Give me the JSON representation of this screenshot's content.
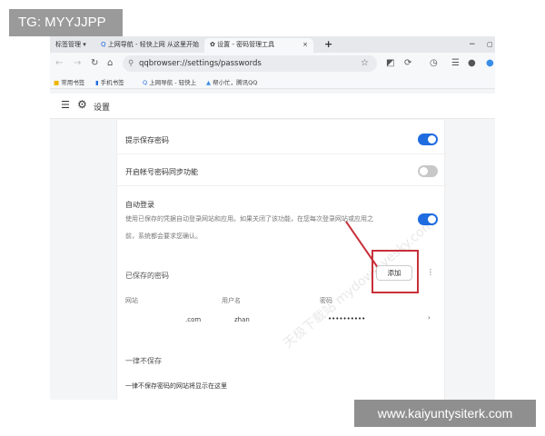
{
  "overlay": {
    "tag": "TG: MYYJJPP",
    "site": "www.kaiyuntysiterk.com"
  },
  "tabs": {
    "manager": "标签管理 ▾",
    "tab1": "上网导航 - 轻快上网 从这里开始",
    "tab2": "设置 - 密码管理工具",
    "close": "×",
    "new": "+"
  },
  "window": {
    "minimize": "−",
    "maximize": "▢"
  },
  "toolbar": {
    "url": "qqbrowser://settings/passwords"
  },
  "bookmarks": [
    "常用书签",
    "手机书签",
    "上网导航 - 轻快上",
    "帮小忙，腾讯QQ"
  ],
  "header": {
    "title": "设置"
  },
  "watermark": "天极下载站 mydown.yesky.com",
  "settings": {
    "offer_save": {
      "label": "提示保存密码",
      "on": true
    },
    "sync": {
      "label": "开启帐号密码同步功能",
      "on": false
    },
    "autologin": {
      "label": "自动登录",
      "desc1": "使用已保存的凭据自动登录网站和应用。如果关闭了该功能，在您每次登录网站或应用之",
      "desc2": "前，系统都会要求您确认。",
      "on": true
    }
  },
  "saved": {
    "title": "已保存的密码",
    "add": "添加",
    "more": "⋮",
    "columns": {
      "site": "网站",
      "user": "用户名",
      "password": "密码"
    },
    "rows": [
      {
        "site": ".com",
        "user": "zhan",
        "password": "••••••••••"
      }
    ]
  },
  "never": {
    "title": "一律不保存",
    "empty": "一律不保存密码的网站将显示在这里"
  },
  "colors": {
    "accent": "#1f6ce0",
    "annotation": "#c8303a"
  }
}
